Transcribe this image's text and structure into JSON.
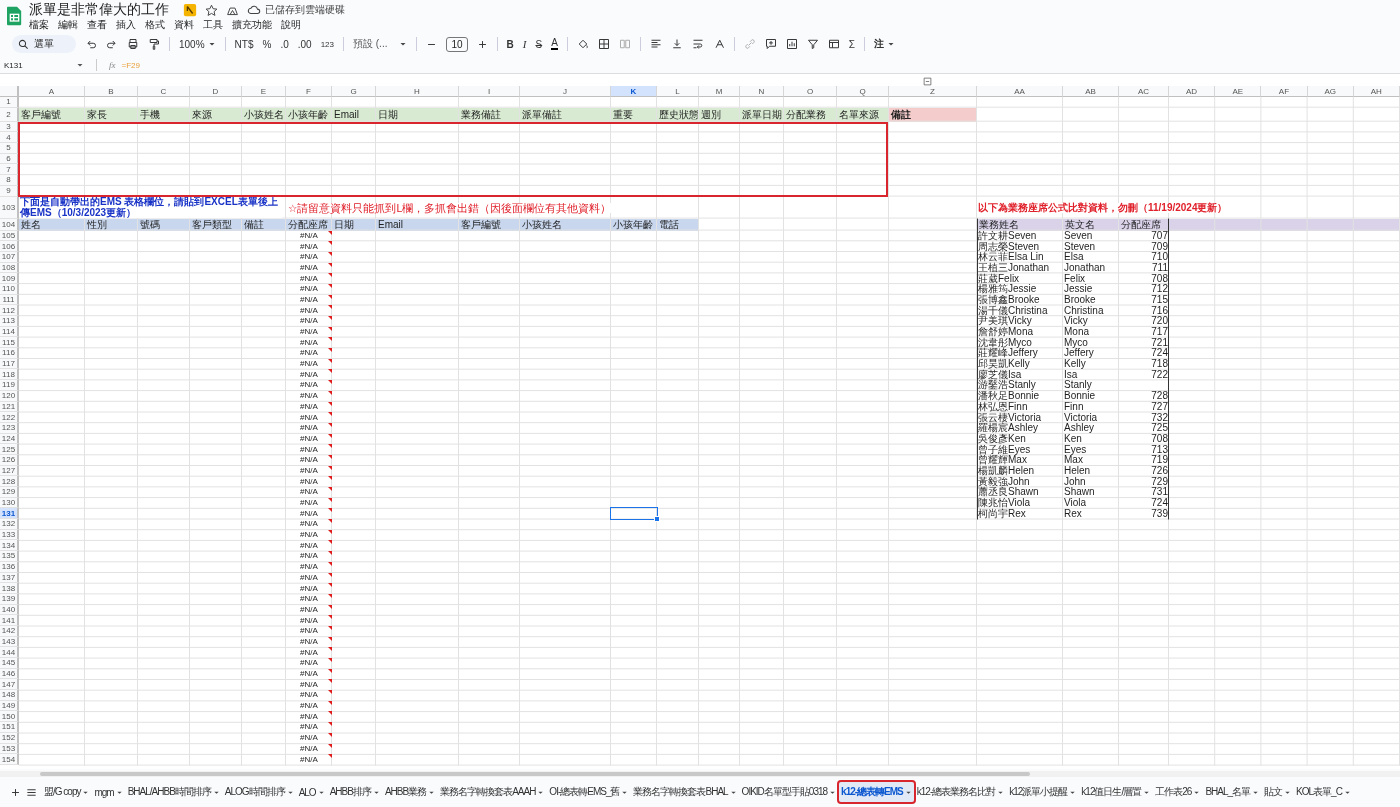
{
  "document": {
    "title": "派單是非常偉大的工作",
    "save_status": "已儲存到雲端硬碟"
  },
  "menu": [
    "檔案",
    "編輯",
    "查看",
    "插入",
    "格式",
    "資料",
    "工具",
    "擴充功能",
    "說明"
  ],
  "toolbar": {
    "search": "選單",
    "zoom": "100%",
    "currency": "NT$",
    "percent": "%",
    "decrease_decimals": ".0",
    "increase_decimals": ".00",
    "number_format": "123",
    "font": "預設 (...",
    "font_size": "10",
    "bold": "B",
    "italic": "I",
    "strikethrough": "S",
    "text_color": "A",
    "functions": "Σ",
    "input_tools": "注"
  },
  "formula_bar": {
    "cell": "K131",
    "function_label": "fx",
    "formula": "=F29"
  },
  "columns": [
    {
      "label": "A",
      "selected": false
    },
    {
      "label": "B",
      "selected": false
    },
    {
      "label": "C",
      "selected": false
    },
    {
      "label": "D",
      "selected": false
    },
    {
      "label": "E",
      "selected": false
    },
    {
      "label": "F",
      "selected": false
    },
    {
      "label": "G",
      "selected": false
    },
    {
      "label": "H",
      "selected": false
    },
    {
      "label": "I",
      "selected": false
    },
    {
      "label": "J",
      "selected": false
    },
    {
      "label": "K",
      "selected": true
    },
    {
      "label": "L",
      "selected": false
    },
    {
      "label": "M",
      "selected": false
    },
    {
      "label": "N",
      "selected": false
    },
    {
      "label": "O",
      "selected": false
    },
    {
      "label": "Q",
      "selected": false
    },
    {
      "label": "Z",
      "selected": false
    },
    {
      "label": "AA",
      "selected": false
    },
    {
      "label": "AB",
      "selected": false
    },
    {
      "label": "AC",
      "selected": false
    },
    {
      "label": "AD",
      "selected": false
    },
    {
      "label": "AE",
      "selected": false
    },
    {
      "label": "AF",
      "selected": false
    },
    {
      "label": "AG",
      "selected": false
    },
    {
      "label": "AH",
      "selected": false
    }
  ],
  "rows": [
    {
      "number": "1",
      "selected": false,
      "kind": "plain"
    },
    {
      "number": "2",
      "selected": false,
      "kind": "field-header",
      "cells": {
        "A": {
          "text": "客戶編號",
          "kind": "label"
        },
        "B": {
          "text": "家長",
          "kind": "label"
        },
        "C": {
          "text": "手機",
          "kind": "label"
        },
        "D": {
          "text": "來源",
          "kind": "label"
        },
        "E": {
          "text": "小孩姓名",
          "kind": "label"
        },
        "F": {
          "text": "小孩年齡",
          "kind": "label"
        },
        "G": {
          "text": "Email",
          "kind": "label"
        },
        "H": {
          "text": "日期",
          "kind": "label"
        },
        "I": {
          "text": "業務備註",
          "kind": "label"
        },
        "J": {
          "text": "派單備註",
          "kind": "label"
        },
        "K": {
          "text": "重要",
          "kind": "label"
        },
        "L": {
          "text": "歷史狀態",
          "kind": "label"
        },
        "M": {
          "text": "週別",
          "kind": "label"
        },
        "N": {
          "text": "派單日期",
          "kind": "label"
        },
        "O": {
          "text": "分配業務",
          "kind": "label"
        },
        "Q": {
          "text": "名單來源",
          "kind": "label"
        },
        "Z": {
          "text": "備註",
          "kind": "highlight"
        }
      }
    },
    {
      "number": "3",
      "selected": false,
      "kind": "plain"
    },
    {
      "number": "4",
      "selected": false,
      "kind": "plain"
    },
    {
      "number": "5",
      "selected": false,
      "kind": "plain"
    },
    {
      "number": "6",
      "selected": false,
      "kind": "plain"
    },
    {
      "number": "7",
      "selected": false,
      "kind": "plain"
    },
    {
      "number": "8",
      "selected": false,
      "kind": "plain"
    },
    {
      "number": "9",
      "selected": false,
      "kind": "plain"
    },
    {
      "number": "103",
      "selected": false,
      "kind": "notes",
      "cells": {
        "A": {
          "text": "下面是自動帶出的EMS 表格欄位，請貼到EXCEL表單後上傳EMS（10/3/2023更新）",
          "kind": "note-blue"
        },
        "F": {
          "text": "☆請留意資料只能抓到L欄，多抓會出錯（因後面欄位有其他資料）",
          "kind": "note-red"
        },
        "AA": {
          "text": "以下為業務座席公式比對資料，勿刪（11/19/2024更新）",
          "kind": "note-title"
        }
      }
    },
    {
      "number": "104",
      "selected": false,
      "kind": "sub-header",
      "cells": {
        "A": {
          "text": "姓名",
          "kind": "label"
        },
        "B": {
          "text": "性別",
          "kind": "label"
        },
        "C": {
          "text": "號碼",
          "kind": "label"
        },
        "D": {
          "text": "客戶類型",
          "kind": "label"
        },
        "E": {
          "text": "備註",
          "kind": "label"
        },
        "F": {
          "text": "分配座席",
          "kind": "label"
        },
        "G": {
          "text": "日期",
          "kind": "label"
        },
        "H": {
          "text": "Email",
          "kind": "label"
        },
        "I": {
          "text": "客戶編號",
          "kind": "label"
        },
        "J": {
          "text": "小孩姓名",
          "kind": "label"
        },
        "K": {
          "text": "小孩年齡",
          "kind": "label"
        },
        "L": {
          "text": "電話",
          "kind": "label"
        },
        "AA": {
          "text": "業務姓名",
          "kind": "ref-head"
        },
        "AB": {
          "text": "英文名",
          "kind": "ref-head"
        },
        "AC": {
          "text": "分配座席",
          "kind": "ref-head"
        }
      }
    },
    {
      "number": "105",
      "selected": false,
      "kind": "plain",
      "cells": {
        "F": {
          "text": "#N/A",
          "kind": "formula-error"
        },
        "AA": {
          "text": "許文耕Seven",
          "kind": "ref"
        },
        "AB": {
          "text": "Seven",
          "kind": "ref"
        },
        "AC": {
          "text": "707",
          "kind": "ref-number"
        }
      }
    },
    {
      "number": "106",
      "selected": false,
      "kind": "plain",
      "cells": {
        "F": {
          "text": "#N/A",
          "kind": "formula-error"
        },
        "AA": {
          "text": "周志榮Steven",
          "kind": "ref"
        },
        "AB": {
          "text": "Steven",
          "kind": "ref"
        },
        "AC": {
          "text": "709",
          "kind": "ref-number"
        }
      }
    },
    {
      "number": "107",
      "selected": false,
      "kind": "plain",
      "cells": {
        "F": {
          "text": "#N/A",
          "kind": "formula-error"
        },
        "AA": {
          "text": "林云菲Elsa Lin",
          "kind": "ref"
        },
        "AB": {
          "text": "Elsa",
          "kind": "ref"
        },
        "AC": {
          "text": "710",
          "kind": "ref-number"
        }
      }
    },
    {
      "number": "108",
      "selected": false,
      "kind": "plain",
      "cells": {
        "F": {
          "text": "#N/A",
          "kind": "formula-error"
        },
        "AA": {
          "text": "王植三Jonathan",
          "kind": "ref"
        },
        "AB": {
          "text": "Jonathan",
          "kind": "ref"
        },
        "AC": {
          "text": "711",
          "kind": "ref-number"
        }
      }
    },
    {
      "number": "109",
      "selected": false,
      "kind": "plain",
      "cells": {
        "F": {
          "text": "#N/A",
          "kind": "formula-error"
        },
        "AA": {
          "text": "莊葳Felix",
          "kind": "ref"
        },
        "AB": {
          "text": "Felix",
          "kind": "ref"
        },
        "AC": {
          "text": "708",
          "kind": "ref-number"
        }
      }
    },
    {
      "number": "110",
      "selected": false,
      "kind": "plain",
      "cells": {
        "F": {
          "text": "#N/A",
          "kind": "formula-error"
        },
        "AA": {
          "text": "楊雅筠Jessie",
          "kind": "ref"
        },
        "AB": {
          "text": "Jessie",
          "kind": "ref"
        },
        "AC": {
          "text": "712",
          "kind": "ref-number"
        }
      }
    },
    {
      "number": "111",
      "selected": false,
      "kind": "plain",
      "cells": {
        "F": {
          "text": "#N/A",
          "kind": "formula-error"
        },
        "AA": {
          "text": "張博鑫Brooke",
          "kind": "ref"
        },
        "AB": {
          "text": "Brooke",
          "kind": "ref"
        },
        "AC": {
          "text": "715",
          "kind": "ref-number"
        }
      }
    },
    {
      "number": "112",
      "selected": false,
      "kind": "plain",
      "cells": {
        "F": {
          "text": "#N/A",
          "kind": "formula-error"
        },
        "AA": {
          "text": "湯千儀Christina",
          "kind": "ref"
        },
        "AB": {
          "text": "Christina",
          "kind": "ref"
        },
        "AC": {
          "text": "716",
          "kind": "ref-number"
        }
      }
    },
    {
      "number": "113",
      "selected": false,
      "kind": "plain",
      "cells": {
        "F": {
          "text": "#N/A",
          "kind": "formula-error"
        },
        "AA": {
          "text": "尹美琪Vicky",
          "kind": "ref"
        },
        "AB": {
          "text": "Vicky",
          "kind": "ref"
        },
        "AC": {
          "text": "720",
          "kind": "ref-number"
        }
      }
    },
    {
      "number": "114",
      "selected": false,
      "kind": "plain",
      "cells": {
        "F": {
          "text": "#N/A",
          "kind": "formula-error"
        },
        "AA": {
          "text": "詹舒婷Mona",
          "kind": "ref"
        },
        "AB": {
          "text": "Mona",
          "kind": "ref"
        },
        "AC": {
          "text": "717",
          "kind": "ref-number"
        }
      }
    },
    {
      "number": "115",
      "selected": false,
      "kind": "plain",
      "cells": {
        "F": {
          "text": "#N/A",
          "kind": "formula-error"
        },
        "AA": {
          "text": "沈韋彤Myco",
          "kind": "ref"
        },
        "AB": {
          "text": "Myco",
          "kind": "ref"
        },
        "AC": {
          "text": "721",
          "kind": "ref-number"
        }
      }
    },
    {
      "number": "116",
      "selected": false,
      "kind": "plain",
      "cells": {
        "F": {
          "text": "#N/A",
          "kind": "formula-error"
        },
        "AA": {
          "text": "莊耀峰Jeffery",
          "kind": "ref"
        },
        "AB": {
          "text": "Jeffery",
          "kind": "ref"
        },
        "AC": {
          "text": "724",
          "kind": "ref-number"
        }
      }
    },
    {
      "number": "117",
      "selected": false,
      "kind": "plain",
      "cells": {
        "F": {
          "text": "#N/A",
          "kind": "formula-error"
        },
        "AA": {
          "text": "邱昊凱Kelly",
          "kind": "ref"
        },
        "AB": {
          "text": "Kelly",
          "kind": "ref"
        },
        "AC": {
          "text": "718",
          "kind": "ref-number"
        }
      }
    },
    {
      "number": "118",
      "selected": false,
      "kind": "plain",
      "cells": {
        "F": {
          "text": "#N/A",
          "kind": "formula-error"
        },
        "AA": {
          "text": "廖芝儀Isa",
          "kind": "ref"
        },
        "AB": {
          "text": "Isa",
          "kind": "ref"
        },
        "AC": {
          "text": "722",
          "kind": "ref-number"
        }
      }
    },
    {
      "number": "119",
      "selected": false,
      "kind": "plain",
      "cells": {
        "F": {
          "text": "#N/A",
          "kind": "formula-error"
        },
        "AA": {
          "text": "游鑿浩Stanly",
          "kind": "ref"
        },
        "AB": {
          "text": "Stanly",
          "kind": "ref"
        }
      }
    },
    {
      "number": "120",
      "selected": false,
      "kind": "plain",
      "cells": {
        "F": {
          "text": "#N/A",
          "kind": "formula-error"
        },
        "AA": {
          "text": "潘秋足Bonnie",
          "kind": "ref"
        },
        "AB": {
          "text": "Bonnie",
          "kind": "ref"
        },
        "AC": {
          "text": "728",
          "kind": "ref-number"
        }
      }
    },
    {
      "number": "121",
      "selected": false,
      "kind": "plain",
      "cells": {
        "F": {
          "text": "#N/A",
          "kind": "formula-error"
        },
        "AA": {
          "text": "林弘恩Finn",
          "kind": "ref"
        },
        "AB": {
          "text": "Finn",
          "kind": "ref"
        },
        "AC": {
          "text": "727",
          "kind": "ref-number"
        }
      }
    },
    {
      "number": "122",
      "selected": false,
      "kind": "plain",
      "cells": {
        "F": {
          "text": "#N/A",
          "kind": "formula-error"
        },
        "AA": {
          "text": "張云棲Victoria",
          "kind": "ref"
        },
        "AB": {
          "text": "Victoria",
          "kind": "ref"
        },
        "AC": {
          "text": "732",
          "kind": "ref-number"
        }
      }
    },
    {
      "number": "123",
      "selected": false,
      "kind": "plain",
      "cells": {
        "F": {
          "text": "#N/A",
          "kind": "formula-error"
        },
        "AA": {
          "text": "羅楊宸Ashley",
          "kind": "ref"
        },
        "AB": {
          "text": "Ashley",
          "kind": "ref"
        },
        "AC": {
          "text": "725",
          "kind": "ref-number"
        }
      }
    },
    {
      "number": "124",
      "selected": false,
      "kind": "plain",
      "cells": {
        "F": {
          "text": "#N/A",
          "kind": "formula-error"
        },
        "AA": {
          "text": "吳俊彥Ken",
          "kind": "ref"
        },
        "AB": {
          "text": "Ken",
          "kind": "ref"
        },
        "AC": {
          "text": "708",
          "kind": "ref-number"
        }
      }
    },
    {
      "number": "125",
      "selected": false,
      "kind": "plain",
      "cells": {
        "F": {
          "text": "#N/A",
          "kind": "formula-error"
        },
        "AA": {
          "text": "曾子維Eyes",
          "kind": "ref"
        },
        "AB": {
          "text": "Eyes",
          "kind": "ref"
        },
        "AC": {
          "text": "713",
          "kind": "ref-number"
        }
      }
    },
    {
      "number": "126",
      "selected": false,
      "kind": "plain",
      "cells": {
        "F": {
          "text": "#N/A",
          "kind": "formula-error"
        },
        "AA": {
          "text": "曾耀輝Max",
          "kind": "ref"
        },
        "AB": {
          "text": "Max",
          "kind": "ref"
        },
        "AC": {
          "text": "719",
          "kind": "ref-number"
        }
      }
    },
    {
      "number": "127",
      "selected": false,
      "kind": "plain",
      "cells": {
        "F": {
          "text": "#N/A",
          "kind": "formula-error"
        },
        "AA": {
          "text": "楊凱麟Helen",
          "kind": "ref"
        },
        "AB": {
          "text": "Helen",
          "kind": "ref"
        },
        "AC": {
          "text": "726",
          "kind": "ref-number"
        }
      }
    },
    {
      "number": "128",
      "selected": false,
      "kind": "plain",
      "cells": {
        "F": {
          "text": "#N/A",
          "kind": "formula-error"
        },
        "AA": {
          "text": "黃毅強John",
          "kind": "ref"
        },
        "AB": {
          "text": "John",
          "kind": "ref"
        },
        "AC": {
          "text": "729",
          "kind": "ref-number"
        }
      }
    },
    {
      "number": "129",
      "selected": false,
      "kind": "plain",
      "cells": {
        "F": {
          "text": "#N/A",
          "kind": "formula-error"
        },
        "AA": {
          "text": "蕭丞良Shawn",
          "kind": "ref"
        },
        "AB": {
          "text": "Shawn",
          "kind": "ref"
        },
        "AC": {
          "text": "731",
          "kind": "ref-number"
        }
      }
    },
    {
      "number": "130",
      "selected": false,
      "kind": "plain",
      "cells": {
        "F": {
          "text": "#N/A",
          "kind": "formula-error"
        },
        "AA": {
          "text": "陳兆怡Viola",
          "kind": "ref"
        },
        "AB": {
          "text": "Viola",
          "kind": "ref"
        },
        "AC": {
          "text": "724",
          "kind": "ref-number"
        }
      }
    },
    {
      "number": "131",
      "selected": true,
      "kind": "plain",
      "cells": {
        "F": {
          "text": "#N/A",
          "kind": "formula-error"
        },
        "AA": {
          "text": "柯尚宇Rex",
          "kind": "ref"
        },
        "AB": {
          "text": "Rex",
          "kind": "ref"
        },
        "AC": {
          "text": "739",
          "kind": "ref-number"
        }
      }
    },
    {
      "number": "132",
      "selected": false,
      "kind": "plain",
      "cells": {
        "F": {
          "text": "#N/A",
          "kind": "formula-error"
        }
      }
    },
    {
      "number": "133",
      "selected": false,
      "kind": "plain",
      "cells": {
        "F": {
          "text": "#N/A",
          "kind": "formula-error"
        }
      }
    },
    {
      "number": "134",
      "selected": false,
      "kind": "plain",
      "cells": {
        "F": {
          "text": "#N/A",
          "kind": "formula-error"
        }
      }
    },
    {
      "number": "135",
      "selected": false,
      "kind": "plain",
      "cells": {
        "F": {
          "text": "#N/A",
          "kind": "formula-error"
        }
      }
    },
    {
      "number": "136",
      "selected": false,
      "kind": "plain",
      "cells": {
        "F": {
          "text": "#N/A",
          "kind": "formula-error"
        }
      }
    },
    {
      "number": "137",
      "selected": false,
      "kind": "plain",
      "cells": {
        "F": {
          "text": "#N/A",
          "kind": "formula-error"
        }
      }
    },
    {
      "number": "138",
      "selected": false,
      "kind": "plain",
      "cells": {
        "F": {
          "text": "#N/A",
          "kind": "formula-error"
        }
      }
    },
    {
      "number": "139",
      "selected": false,
      "kind": "plain",
      "cells": {
        "F": {
          "text": "#N/A",
          "kind": "formula-error"
        }
      }
    },
    {
      "number": "140",
      "selected": false,
      "kind": "plain",
      "cells": {
        "F": {
          "text": "#N/A",
          "kind": "formula-error"
        }
      }
    },
    {
      "number": "141",
      "selected": false,
      "kind": "plain",
      "cells": {
        "F": {
          "text": "#N/A",
          "kind": "formula-error"
        }
      }
    },
    {
      "number": "142",
      "selected": false,
      "kind": "plain",
      "cells": {
        "F": {
          "text": "#N/A",
          "kind": "formula-error"
        }
      }
    },
    {
      "number": "143",
      "selected": false,
      "kind": "plain",
      "cells": {
        "F": {
          "text": "#N/A",
          "kind": "formula-error"
        }
      }
    },
    {
      "number": "144",
      "selected": false,
      "kind": "plain",
      "cells": {
        "F": {
          "text": "#N/A",
          "kind": "formula-error"
        }
      }
    },
    {
      "number": "145",
      "selected": false,
      "kind": "plain",
      "cells": {
        "F": {
          "text": "#N/A",
          "kind": "formula-error"
        }
      }
    },
    {
      "number": "146",
      "selected": false,
      "kind": "plain",
      "cells": {
        "F": {
          "text": "#N/A",
          "kind": "formula-error"
        }
      }
    },
    {
      "number": "147",
      "selected": false,
      "kind": "plain",
      "cells": {
        "F": {
          "text": "#N/A",
          "kind": "formula-error"
        }
      }
    },
    {
      "number": "148",
      "selected": false,
      "kind": "plain",
      "cells": {
        "F": {
          "text": "#N/A",
          "kind": "formula-error"
        }
      }
    },
    {
      "number": "149",
      "selected": false,
      "kind": "plain",
      "cells": {
        "F": {
          "text": "#N/A",
          "kind": "formula-error"
        }
      }
    },
    {
      "number": "150",
      "selected": false,
      "kind": "plain",
      "cells": {
        "F": {
          "text": "#N/A",
          "kind": "formula-error"
        }
      }
    },
    {
      "number": "151",
      "selected": false,
      "kind": "plain",
      "cells": {
        "F": {
          "text": "#N/A",
          "kind": "formula-error"
        }
      }
    },
    {
      "number": "152",
      "selected": false,
      "kind": "plain",
      "cells": {
        "F": {
          "text": "#N/A",
          "kind": "formula-error"
        }
      }
    },
    {
      "number": "153",
      "selected": false,
      "kind": "plain",
      "cells": {
        "F": {
          "text": "#N/A",
          "kind": "formula-error"
        }
      }
    },
    {
      "number": "154",
      "selected": false,
      "kind": "plain",
      "cells": {
        "F": {
          "text": "#N/A",
          "kind": "formula-error"
        }
      }
    }
  ],
  "sheet_tabs": [
    {
      "label": "盟/G copy",
      "selected": false
    },
    {
      "label": "mgm",
      "selected": false
    },
    {
      "label": "BHAL/AHBB時間排序",
      "selected": false
    },
    {
      "label": "ALOG時間排序",
      "selected": false
    },
    {
      "label": "ALO",
      "selected": false
    },
    {
      "label": "AHBB排序",
      "selected": false
    },
    {
      "label": "AHBB業務",
      "selected": false
    },
    {
      "label": "業務名字轉換套表AAAH",
      "selected": false
    },
    {
      "label": "OI-總表轉EMS_舊",
      "selected": false
    },
    {
      "label": "業務名字轉換套表BHAL",
      "selected": false
    },
    {
      "label": "OIKID名單型手貼0318",
      "selected": false
    },
    {
      "label": "k12-總表轉EMS",
      "selected": true
    },
    {
      "label": "k12-總表業務名比對",
      "selected": false
    },
    {
      "label": "k12派單小提醒",
      "selected": false
    },
    {
      "label": "k12值日生/層置",
      "selected": false
    },
    {
      "label": "工作表26",
      "selected": false
    },
    {
      "label": "BHAL_名單",
      "selected": false
    },
    {
      "label": "貼文",
      "selected": false
    },
    {
      "label": "KOL表單_C",
      "selected": false
    }
  ]
}
